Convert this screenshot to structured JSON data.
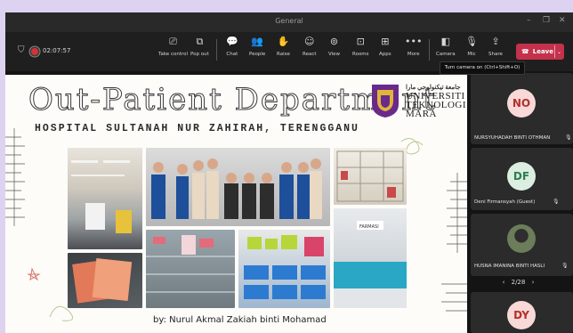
{
  "window": {
    "title": "General",
    "minimize": "–",
    "maximize": "❐",
    "close": "✕"
  },
  "meeting": {
    "timer": "02:07:57"
  },
  "toolbar": {
    "items": [
      {
        "label": "Take control",
        "icon": "⎚"
      },
      {
        "label": "Pop out",
        "icon": "⧉"
      },
      {
        "label": "Chat",
        "icon": "💬"
      },
      {
        "label": "People",
        "icon": "👥"
      },
      {
        "label": "Raise",
        "icon": "✋"
      },
      {
        "label": "React",
        "icon": "☺"
      },
      {
        "label": "View",
        "icon": "⊚"
      },
      {
        "label": "Rooms",
        "icon": "⊡"
      },
      {
        "label": "Apps",
        "icon": "⊞"
      },
      {
        "label": "More",
        "icon": "•••"
      },
      {
        "label": "Camera",
        "icon": "◧"
      },
      {
        "label": "Mic",
        "icon": "🎙"
      },
      {
        "label": "Share",
        "icon": "⇪"
      }
    ],
    "leave_label": "Leave",
    "leave_dropdown": "⌄"
  },
  "tooltip": {
    "text": "Turn camera on (Ctrl+Shift+O)"
  },
  "slide": {
    "title": "Out-Patient Department",
    "subtitle": "HOSPITAL SULTANAH NUR ZAHIRAH, TERENGGANU",
    "university_lines": [
      "UNIVERSITI",
      "TEKNOLOGI",
      "MARA"
    ],
    "university_script": "جامعة تيكنولوجي مارا",
    "pharmacy_sign": "FARMASI",
    "author": "by: Nurul Akmal Zakiah binti Mohamad"
  },
  "participants": [
    {
      "initials": "NO",
      "name": "NURSYUHADAH BINTI OTHMAN",
      "avatar_bg": "#f7d9d8",
      "avatar_fg": "#b3312a"
    },
    {
      "initials": "DF",
      "name": "Deni Firmansyah (Guest)",
      "avatar_bg": "#dceee0",
      "avatar_fg": "#2e7d4f"
    },
    {
      "initials": "",
      "name": "HUSNA IMANINA BINTI HASLI",
      "avatar_bg": "#6b7d5a",
      "avatar_fg": "#ffffff"
    },
    {
      "initials": "DY",
      "name": "",
      "avatar_bg": "#f7d9d8",
      "avatar_fg": "#b3312a"
    }
  ],
  "pager": {
    "text": "2/28",
    "prev": "‹",
    "next": "›"
  },
  "colors": {
    "leave": "#c4314b",
    "recording": "#d13438",
    "logo_purple": "#6a2a8a",
    "logo_gold": "#e0b43a"
  }
}
